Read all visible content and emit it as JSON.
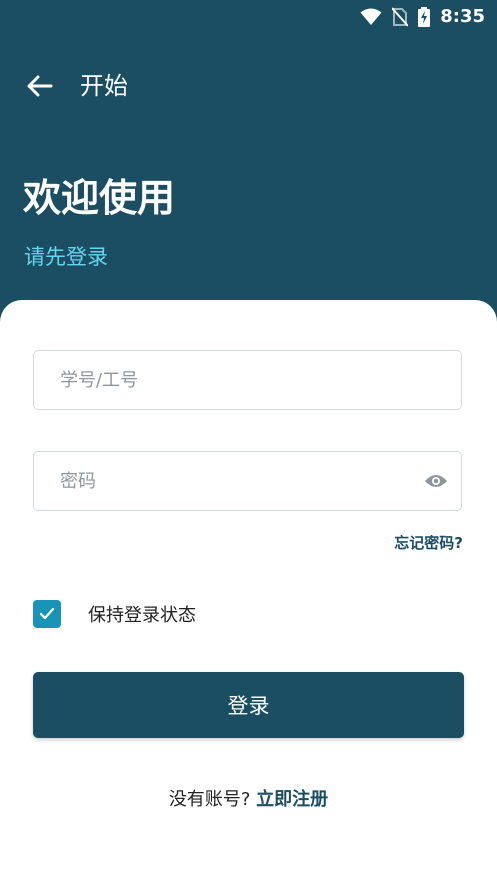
{
  "status_bar": {
    "time": "8:35",
    "icons": [
      "wifi-icon",
      "no-sim-icon",
      "battery-charging-icon"
    ]
  },
  "topbar": {
    "back_icon": "arrow-left-icon",
    "title": "开始"
  },
  "welcome": {
    "title": "欢迎使用",
    "subtitle": "请先登录"
  },
  "form": {
    "username_placeholder": "学号/工号",
    "username_value": "",
    "password_placeholder": "密码",
    "password_value": "",
    "password_toggle_icon": "eye-icon",
    "forgot_label": "忘记密码?",
    "remember_label": "保持登录状态",
    "remember_checked": true,
    "login_label": "登录"
  },
  "signup": {
    "prompt": "没有账号?",
    "link": "立即注册"
  },
  "colors": {
    "primary": "#1b4e63",
    "accent_text": "#63d6ee",
    "checkbox": "#1794b8"
  }
}
